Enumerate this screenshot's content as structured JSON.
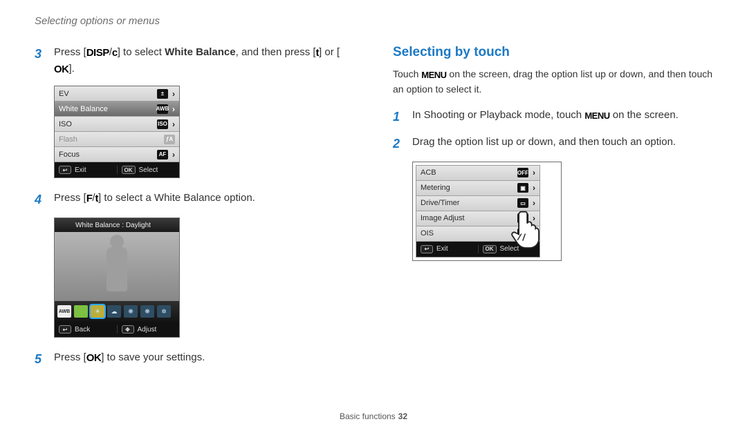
{
  "header": "Selecting options or menus",
  "left": {
    "steps": [
      {
        "num": "3",
        "pre": "Press [",
        "glyph1": "DISP",
        "sep1": "/",
        "glyph2": "c",
        "mid": "] to select ",
        "bold": "White Balance",
        "mid2": ", and then press [",
        "glyph3": "t",
        "mid3": "] or [",
        "glyph4": "OK",
        "post": "]."
      },
      {
        "num": "4",
        "pre": "Press [",
        "glyph1": "F",
        "sep1": "/",
        "glyph2": "t",
        "post2": "] to select a White Balance option."
      },
      {
        "num": "5",
        "pre": "Press [",
        "glyph1": "OK",
        "post2": "] to save your settings."
      }
    ],
    "menu": {
      "rows": [
        {
          "label": "EV",
          "icon": "±",
          "sel": false,
          "dis": false
        },
        {
          "label": "White Balance",
          "icon": "AWB",
          "sel": true,
          "dis": false
        },
        {
          "label": "ISO",
          "icon": "ISO",
          "sel": false,
          "dis": false
        },
        {
          "label": "Flash",
          "icon": "ƒA",
          "sel": false,
          "dis": true
        },
        {
          "label": "Focus",
          "icon": "AF",
          "sel": false,
          "dis": false
        }
      ],
      "footer_left_icon": "↩",
      "footer_left": "Exit",
      "footer_right_icon": "OK",
      "footer_right": "Select"
    },
    "preview": {
      "title": "White Balance : Daylight",
      "footer_left_icon": "↩",
      "footer_left": "Back",
      "footer_right_icon": "✥",
      "footer_right": "Adjust"
    }
  },
  "right": {
    "title": "Selecting by touch",
    "intro_pre": "Touch ",
    "intro_glyph": "MENU",
    "intro_post": " on the screen, drag the option list up or down, and then touch an option to select it.",
    "steps": [
      {
        "num": "1",
        "pre": "In Shooting or Playback mode, touch ",
        "glyph1": "MENU",
        "post2": " on the screen."
      },
      {
        "num": "2",
        "text": "Drag the option list up or down, and then touch an option."
      }
    ],
    "menu": {
      "rows": [
        {
          "label": "ACB",
          "icon": "OFF"
        },
        {
          "label": "Metering",
          "icon": "▣"
        },
        {
          "label": "Drive/Timer",
          "icon": "▭"
        },
        {
          "label": "Image Adjust",
          "icon": "▭"
        },
        {
          "label": "OIS",
          "icon": "))"
        }
      ],
      "footer_left_icon": "↩",
      "footer_left": "Exit",
      "footer_right_icon": "OK",
      "footer_right": "Select"
    }
  },
  "page_footer": {
    "section": "Basic functions",
    "num": "32"
  }
}
